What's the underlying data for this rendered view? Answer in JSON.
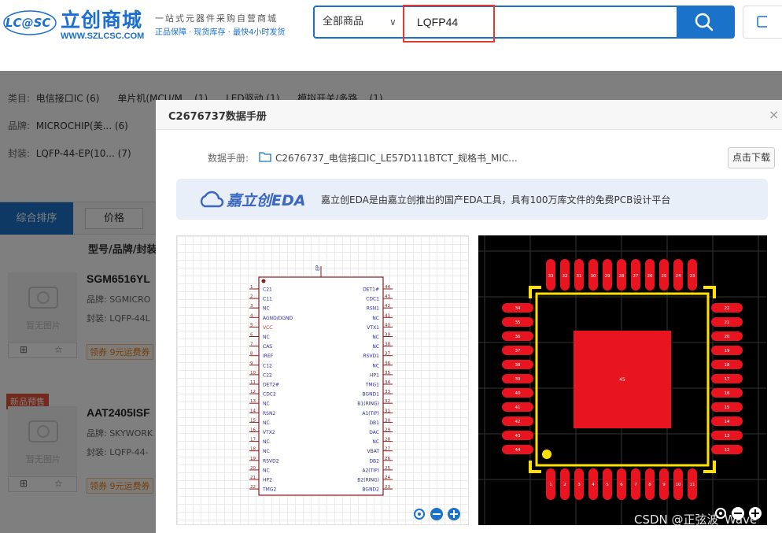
{
  "header": {
    "logo_badge": "LC@SC",
    "logo_cn": "立创商城",
    "logo_url": "WWW.SZLCSC.COM",
    "slogan": "一站式元器件采购自营商城",
    "slogan_sub": "正品保障 · 现货库存 · 最快4小时发货",
    "search_category": "全部商品",
    "search_value": "LQFP44"
  },
  "filters": [
    {
      "key": "类目:",
      "items": [
        "电信接口IC (6)",
        "单片机(MCU/M... (1)",
        "LED驱动 (1)",
        "模拟开关/多路... (1)"
      ]
    },
    {
      "key": "品牌:",
      "items": [
        "MICROCHIP(美... (6)"
      ]
    },
    {
      "key": "封装:",
      "items": [
        "LQFP-44-EP(10... (7)"
      ]
    }
  ],
  "sort": {
    "main": "综合排序",
    "price": "价格"
  },
  "list_header": "型号/品牌/封装",
  "products": [
    {
      "name": "SGM6516YL",
      "brand": "品牌: SGMICRO",
      "package": "封装: LQFP-44L",
      "no_image": "暂无图片",
      "coupon": "领券 9元运费券",
      "tag": ""
    },
    {
      "name": "AAT2405ISF",
      "brand": "品牌: SKYWORK",
      "package": "封装: LQFP-44-",
      "no_image": "暂无图片",
      "coupon": "领券 9元运费券",
      "tag": "新品预售"
    }
  ],
  "modal": {
    "title": "C2676737数据手册",
    "close": "×",
    "datasheet_label": "数据手册:",
    "datasheet_file": "C2676737_电信接口IC_LE57D111BTCT_规格书_MIC...",
    "download_btn": "点击下载",
    "eda_logo": "嘉立创EDA",
    "eda_desc": "嘉立创EDA是由嘉立创推出的国产EDA工具，具有100万库文件的免费PCB设计平台"
  },
  "symbol": {
    "ep_label": "EP",
    "left_pins": [
      "C21",
      "C11",
      "NC",
      "AGND/DGND",
      "VCC",
      "NC",
      "CAS",
      "IREF",
      "C12",
      "C22",
      "DET2#",
      "CDC2",
      "NC",
      "RSN2",
      "NC",
      "VTX2",
      "NC",
      "NC",
      "RSVD2",
      "NC",
      "HP2",
      "TMG2"
    ],
    "right_pins": [
      "DET1#",
      "CDC1",
      "RSN1",
      "NC",
      "VTX1",
      "NC",
      "NC",
      "RSVD1",
      "NC",
      "HP1",
      "TMG1",
      "BGND1",
      "B1(RING)",
      "A1(TIP)",
      "DB1",
      "DAC",
      "NC",
      "VBAT",
      "DB2",
      "A2(TIP)",
      "B2(RING)",
      "BGND2"
    ],
    "left_nums": [
      "1",
      "2",
      "3",
      "4",
      "5",
      "6",
      "7",
      "8",
      "9",
      "10",
      "11",
      "12",
      "13",
      "14",
      "15",
      "16",
      "17",
      "18",
      "19",
      "20",
      "21",
      "22"
    ],
    "right_nums": [
      "44",
      "43",
      "42",
      "41",
      "40",
      "39",
      "38",
      "37",
      "36",
      "35",
      "34",
      "33",
      "32",
      "31",
      "30",
      "29",
      "28",
      "27",
      "26",
      "25",
      "24",
      "23"
    ]
  },
  "footprint": {
    "top_pads": [
      "33",
      "32",
      "31",
      "30",
      "29",
      "28",
      "27",
      "26",
      "25",
      "24",
      "23"
    ],
    "bottom_pads": [
      "1",
      "2",
      "3",
      "4",
      "5",
      "6",
      "7",
      "8",
      "9",
      "10",
      "11"
    ],
    "left_pads": [
      "34",
      "35",
      "36",
      "37",
      "38",
      "39",
      "40",
      "41",
      "42",
      "43",
      "44"
    ],
    "right_pads": [
      "22",
      "21",
      "20",
      "19",
      "18",
      "17",
      "16",
      "15",
      "14",
      "13",
      "12"
    ],
    "center_pad": "45"
  },
  "watermark": "CSDN @正弦波_Wave",
  "colors": {
    "brand_blue": "#1a73c8",
    "pad_red": "#e8141f",
    "silk_yellow": "#ffe000",
    "highlight_red": "#e53935"
  }
}
